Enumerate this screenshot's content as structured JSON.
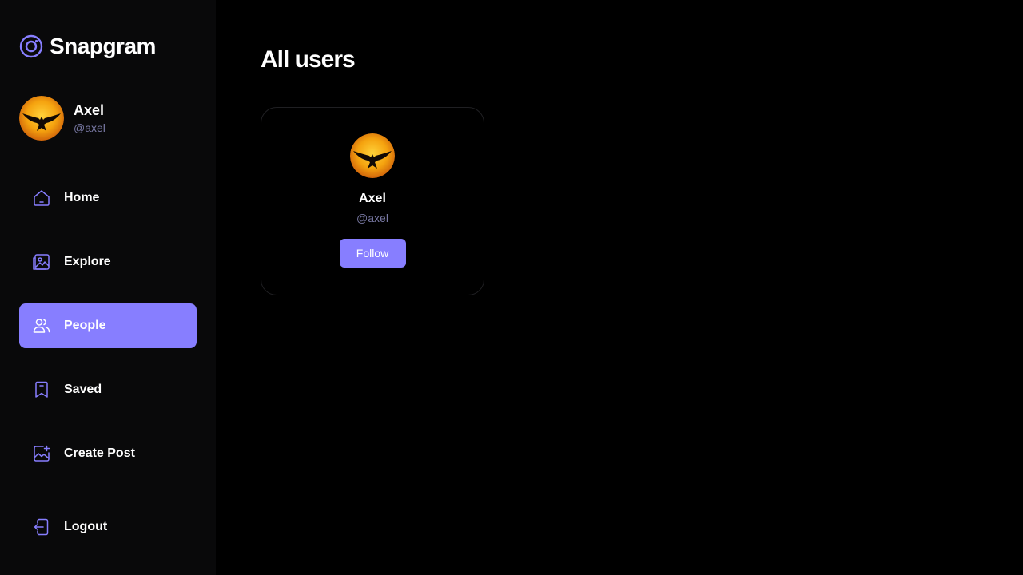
{
  "app": {
    "name": "Snapgram"
  },
  "colors": {
    "accent": "#877eff",
    "muted": "#7878a3",
    "sidebar_bg": "#09090a",
    "background": "#000000"
  },
  "current_user": {
    "name": "Axel",
    "handle": "@axel",
    "avatar_icon": "bird-avatar-icon"
  },
  "sidebar": {
    "items": [
      {
        "label": "Home",
        "icon": "home-icon",
        "active": false
      },
      {
        "label": "Explore",
        "icon": "explore-icon",
        "active": false
      },
      {
        "label": "People",
        "icon": "people-icon",
        "active": true
      },
      {
        "label": "Saved",
        "icon": "bookmark-icon",
        "active": false
      },
      {
        "label": "Create Post",
        "icon": "gallery-add-icon",
        "active": false
      }
    ],
    "logout_label": "Logout"
  },
  "main": {
    "title": "All users",
    "users": [
      {
        "name": "Axel",
        "handle": "@axel",
        "button_label": "Follow"
      }
    ]
  }
}
